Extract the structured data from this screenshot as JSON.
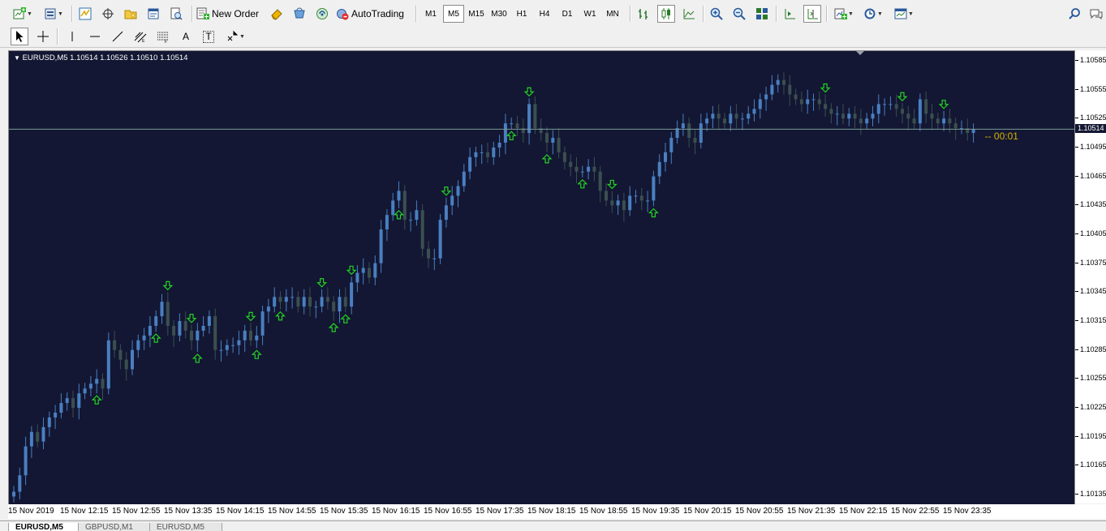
{
  "toolbar": {
    "new_order_label": "New Order",
    "autotrading_label": "AutoTrading",
    "timeframes": [
      "M1",
      "M5",
      "M15",
      "M30",
      "H1",
      "H4",
      "D1",
      "W1",
      "MN"
    ],
    "active_timeframe": "M5",
    "icons": {
      "new-chart": "new-chart-icon",
      "profiles": "profiles-icon",
      "market-watch": "market-watch-icon",
      "navigator": "navigator-icon",
      "favorites": "favorites-icon",
      "terminal": "terminal-icon",
      "strategy-tester": "strategy-tester-icon",
      "metaeditor": "metaeditor-icon",
      "market": "market-icon",
      "signals": "signals-icon",
      "bar-chart": "bar-chart-icon",
      "candlesticks": "candlesticks-icon",
      "line-chart": "line-chart-icon",
      "zoom-in": "zoom-in-icon",
      "zoom-out": "zoom-out-icon",
      "tile-windows": "tile-windows-icon",
      "auto-scroll": "auto-scroll-icon",
      "chart-shift": "chart-shift-icon",
      "indicators": "indicators-icon",
      "periods": "periods-icon",
      "templates": "templates-icon",
      "search": "search-icon",
      "chat": "chat-icon"
    }
  },
  "drawing_toolbar": {
    "tools": [
      "cursor",
      "crosshair",
      "vertical-line",
      "horizontal-line",
      "trendline",
      "fibonacci",
      "fibonacci-channel",
      "text",
      "text-label",
      "arrows"
    ],
    "text_tool_label": "A",
    "text_label_tool_label": "T"
  },
  "chart": {
    "title": "EURUSD,M5  1.10514 1.10526 1.10510 1.10514",
    "current_price": "1.10514",
    "timer": "-- 00:01",
    "colors": {
      "background": "#131733",
      "bull": "#4a7fc1",
      "bear": "#3b4f4f",
      "arrow": "#22d222",
      "price_line": "#7a9a9a",
      "timer": "#d4b000"
    },
    "price_labels": [
      "1.10585",
      "1.10555",
      "1.10525",
      "1.10495",
      "1.10465",
      "1.10435",
      "1.10405",
      "1.10375",
      "1.10345",
      "1.10315",
      "1.10285",
      "1.10255",
      "1.10225",
      "1.10195",
      "1.10165",
      "1.10135"
    ],
    "time_labels": [
      "15 Nov 2019",
      "15 Nov 12:15",
      "15 Nov 12:55",
      "15 Nov 13:35",
      "15 Nov 14:15",
      "15 Nov 14:55",
      "15 Nov 15:35",
      "15 Nov 16:15",
      "15 Nov 16:55",
      "15 Nov 17:35",
      "15 Nov 18:15",
      "15 Nov 18:55",
      "15 Nov 19:35",
      "15 Nov 20:15",
      "15 Nov 20:55",
      "15 Nov 21:35",
      "15 Nov 22:15",
      "15 Nov 22:55",
      "15 Nov 23:35"
    ]
  },
  "tabs": [
    {
      "label": "EURUSD,M5",
      "active": true
    },
    {
      "label": "GBPUSD,M1",
      "active": false
    },
    {
      "label": "EURUSD,M5",
      "active": false
    }
  ],
  "chart_data": {
    "type": "candlestick",
    "symbol": "EURUSD",
    "timeframe": "M5",
    "ylim": [
      1.10125,
      1.10595
    ],
    "close": [
      1.10138,
      1.10155,
      1.10185,
      1.102,
      1.1019,
      1.10205,
      1.10215,
      1.1022,
      1.1023,
      1.10235,
      1.10225,
      1.1024,
      1.10245,
      1.1025,
      1.10255,
      1.10245,
      1.10295,
      1.10285,
      1.10275,
      1.10265,
      1.10285,
      1.10295,
      1.103,
      1.1031,
      1.1032,
      1.10335,
      1.1031,
      1.103,
      1.10315,
      1.10305,
      1.10295,
      1.10305,
      1.1031,
      1.1032,
      1.10285,
      1.10285,
      1.1029,
      1.1029,
      1.10295,
      1.10305,
      1.10295,
      1.103,
      1.10325,
      1.1033,
      1.1034,
      1.10335,
      1.1034,
      1.1034,
      1.1033,
      1.1034,
      1.1033,
      1.1033,
      1.1034,
      1.10335,
      1.10325,
      1.1034,
      1.1033,
      1.10355,
      1.10365,
      1.1037,
      1.1036,
      1.10375,
      1.1041,
      1.10425,
      1.1044,
      1.1045,
      1.1042,
      1.1042,
      1.1043,
      1.1039,
      1.1038,
      1.1038,
      1.1042,
      1.10435,
      1.10445,
      1.10455,
      1.1047,
      1.10485,
      1.1049,
      1.1049,
      1.10485,
      1.10495,
      1.105,
      1.1052,
      1.1052,
      1.10515,
      1.1051,
      1.1054,
      1.10515,
      1.1051,
      1.105,
      1.10505,
      1.1049,
      1.1048,
      1.10475,
      1.1047,
      1.1047,
      1.10475,
      1.1047,
      1.1045,
      1.1044,
      1.10435,
      1.1044,
      1.1043,
      1.10445,
      1.10445,
      1.1044,
      1.1044,
      1.10465,
      1.1048,
      1.1049,
      1.10505,
      1.10515,
      1.1052,
      1.10505,
      1.105,
      1.1052,
      1.10525,
      1.1053,
      1.10525,
      1.1052,
      1.1053,
      1.10525,
      1.10525,
      1.1053,
      1.10535,
      1.10545,
      1.1055,
      1.1056,
      1.10565,
      1.1056,
      1.1055,
      1.10545,
      1.1054,
      1.10545,
      1.10545,
      1.1054,
      1.10535,
      1.1053,
      1.1053,
      1.10525,
      1.1053,
      1.10525,
      1.1052,
      1.10525,
      1.1053,
      1.1054,
      1.1054,
      1.1054,
      1.10535,
      1.1053,
      1.10525,
      1.1052,
      1.10545,
      1.1053,
      1.10525,
      1.1052,
      1.10525,
      1.1052,
      1.10515,
      1.10515,
      1.1051,
      1.10514
    ],
    "up_arrows": [
      0,
      14,
      24,
      31,
      41,
      45,
      54,
      56,
      65,
      84,
      90,
      96,
      108
    ],
    "down_arrows": [
      26,
      30,
      40,
      52,
      57,
      73,
      87,
      101,
      137,
      150,
      157
    ]
  }
}
